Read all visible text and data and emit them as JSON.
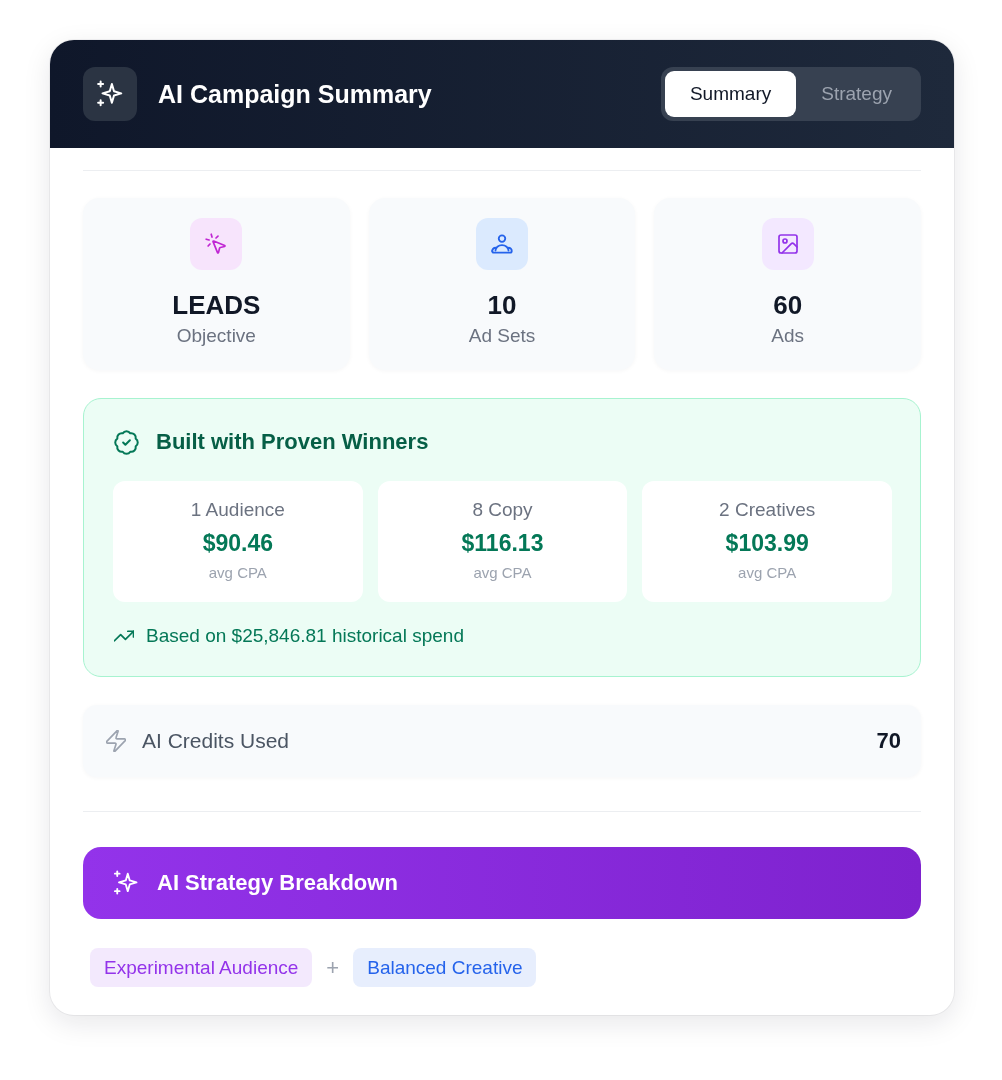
{
  "header": {
    "title": "AI Campaign Summary",
    "tabs": [
      {
        "label": "Summary",
        "selected": true
      },
      {
        "label": "Strategy",
        "selected": false
      }
    ]
  },
  "stats": [
    {
      "kind": "objective",
      "value": "LEADS",
      "label": "Objective"
    },
    {
      "kind": "ad_sets",
      "value": "10",
      "label": "Ad Sets"
    },
    {
      "kind": "ads",
      "value": "60",
      "label": "Ads"
    }
  ],
  "winners": {
    "title": "Built with Proven Winners",
    "metrics": [
      {
        "label": "1 Audience",
        "value": "$90.46",
        "caption": "avg CPA"
      },
      {
        "label": "8 Copy",
        "value": "$116.13",
        "caption": "avg CPA"
      },
      {
        "label": "2 Creatives",
        "value": "$103.99",
        "caption": "avg CPA"
      }
    ],
    "note": "Based on $25,846.81 historical spend"
  },
  "credits": {
    "label": "AI Credits Used",
    "value": "70"
  },
  "breakdown_button": {
    "label": "AI Strategy Breakdown"
  },
  "tags": [
    {
      "label": "Experimental Audience",
      "color": "#9333ea"
    },
    {
      "label": "Balanced Creative",
      "color": "#2563eb"
    }
  ],
  "tag_separator": "+"
}
